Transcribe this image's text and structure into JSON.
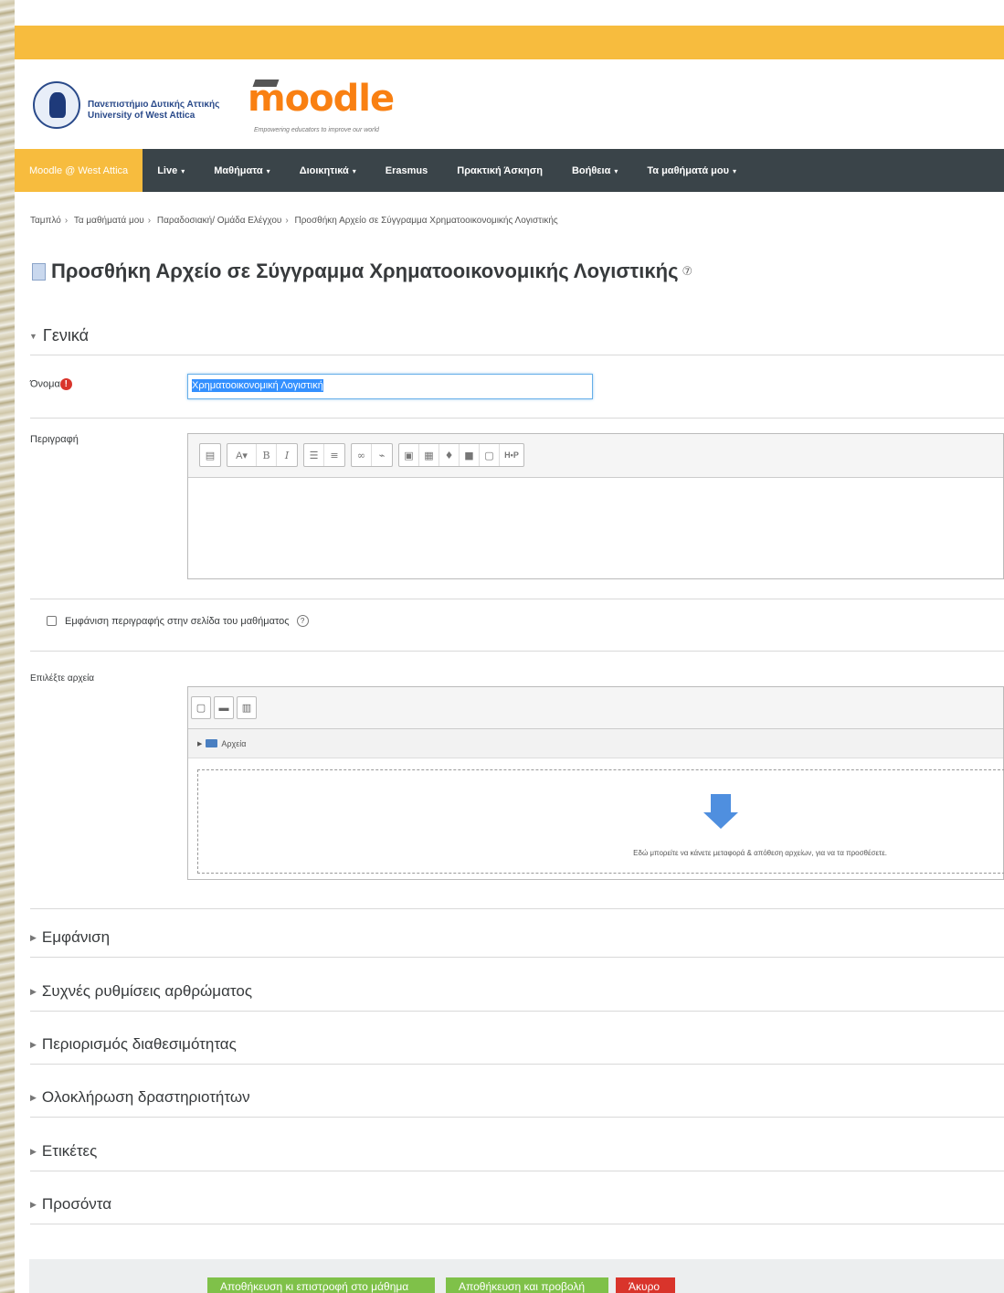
{
  "header": {
    "university_line1": "Πανεπιστήμιο Δυτικής Αττικής",
    "university_line2": "University of West Attica",
    "moodle_logo": "moodle",
    "moodle_tagline": "Empowering educators to improve our world",
    "accent_color": "#f7bc3e"
  },
  "nav": {
    "brand": "Moodle @ West Attica",
    "items": [
      {
        "label": "Live",
        "caret": "▾"
      },
      {
        "label": "Μαθήματα",
        "caret": "▾"
      },
      {
        "label": "Διοικητικά",
        "caret": "▾"
      },
      {
        "label": "Erasmus",
        "caret": ""
      },
      {
        "label": "Πρακτική Άσκηση",
        "caret": ""
      },
      {
        "label": "Βοήθεια",
        "caret": "▾"
      },
      {
        "label": "Τα μαθήματά μου",
        "caret": "▾"
      }
    ]
  },
  "breadcrumb": [
    "Ταμπλό",
    "Τα μαθήματά μου",
    "Παραδοσιακή/ Ομάδα Ελέγχου",
    "Προσθήκη Αρχείο σε Σύγγραμμα Χρηματοοικονομικής Λογιστικής"
  ],
  "page_title": "Προσθήκη Αρχείο σε Σύγγραμμα Χρηματοοικονομικής Λογιστικής",
  "general_section": {
    "title": "Γενικά",
    "name_label": "Όνομα",
    "name_value": "Χρηματοοικονομική Λογιστική",
    "description_label": "Περιγραφή",
    "show_description_label": "Εμφάνιση περιγραφής στην σελίδα του μαθήματος",
    "select_files_label": "Επιλέξτε αρχεία",
    "folder_label": "Αρχεία",
    "dropzone_text": "Εδώ μπορείτε να κάνετε μεταφορά & απόθεση αρχείων, για να τα προσθέσετε."
  },
  "collapsed_sections": [
    "Εμφάνιση",
    "Συχνές ρυθμίσεις αρθρώματος",
    "Περιορισμός διαθεσιμότητας",
    "Ολοκλήρωση δραστηριοτήτων",
    "Ετικέτες",
    "Προσόντα"
  ],
  "buttons": {
    "save_return": "Αποθήκευση κι επιστροφή στο μάθημα",
    "save_display": "Αποθήκευση και προβολή",
    "cancel": "Άκυρο"
  }
}
